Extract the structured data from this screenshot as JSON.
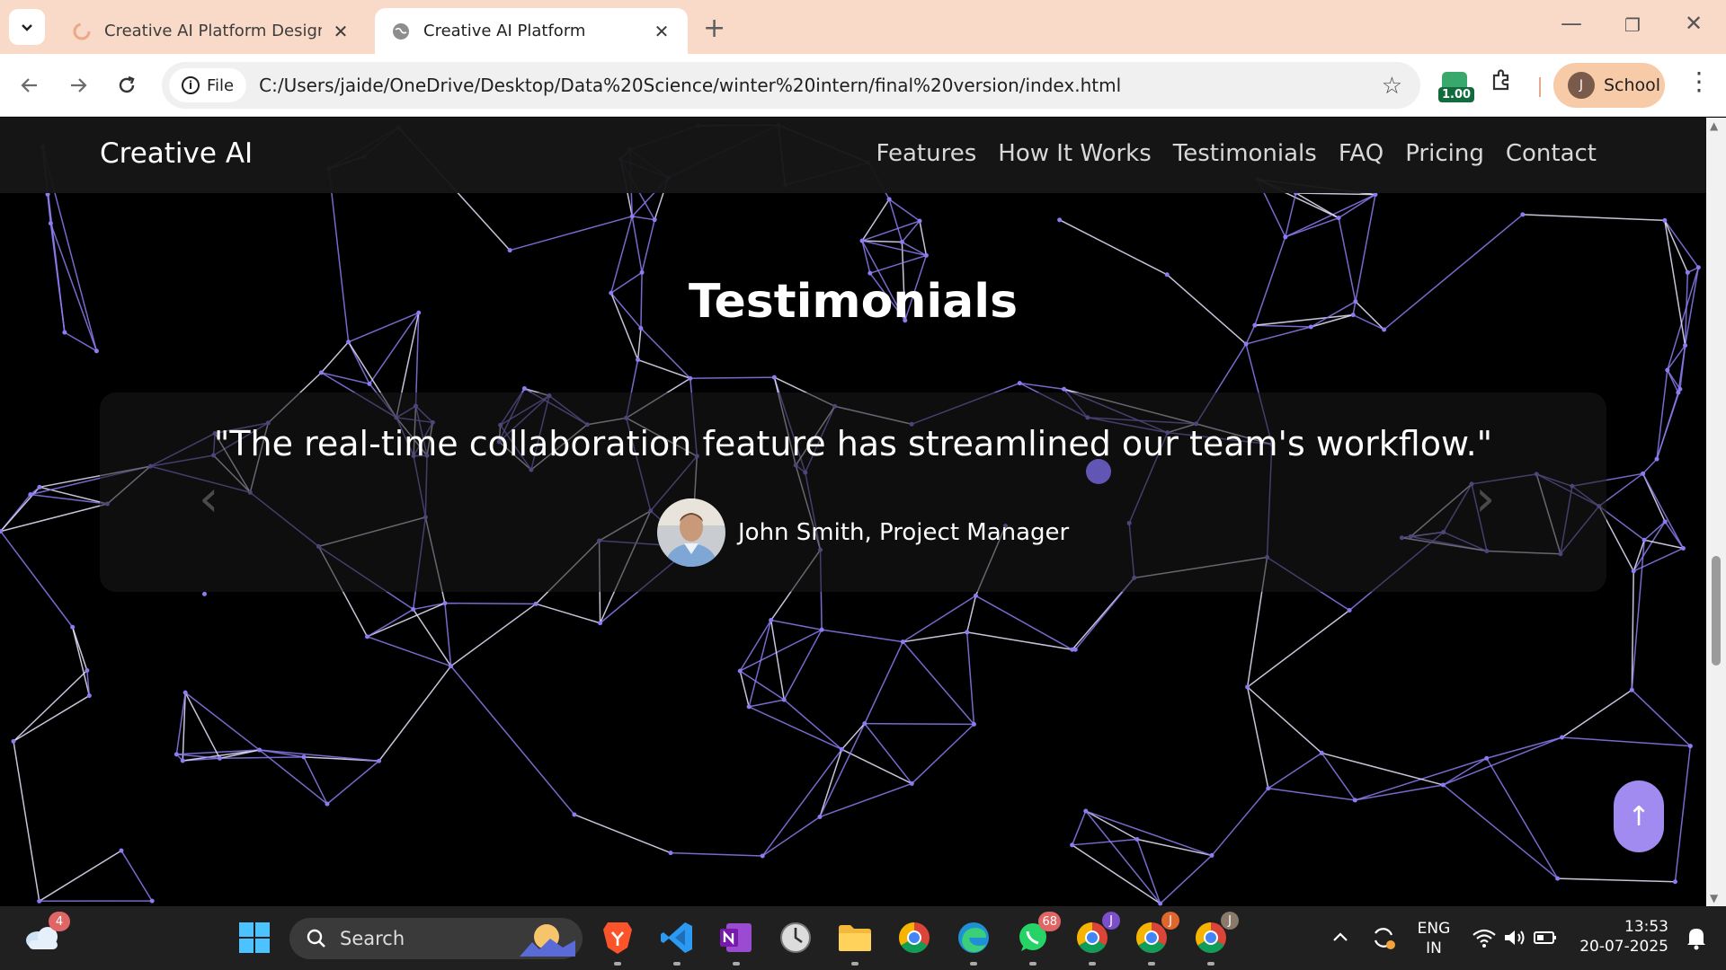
{
  "browser": {
    "tabs": [
      {
        "title": "Creative AI Platform Design - Gemini",
        "active": false
      },
      {
        "title": "Creative AI Platform",
        "active": true
      }
    ],
    "site_chip_label": "File",
    "url": "C:/Users/jaide/OneDrive/Desktop/Data%20Science/winter%20intern/final%20version/index.html",
    "extension_badge": "1.00",
    "profile": {
      "initial": "J",
      "label": "School"
    }
  },
  "site": {
    "brand": "Creative AI",
    "nav": [
      "Features",
      "How It Works",
      "Testimonials",
      "FAQ",
      "Pricing",
      "Contact"
    ],
    "section_title": "Testimonials",
    "testimonial": {
      "quote": "\"The real-time collaboration feature has streamlined our team's workflow.\"",
      "author": "John Smith, Project Manager"
    },
    "back_to_top": "↑",
    "accent_color": "#a18af0",
    "network_line_color": "#8b7cf0"
  },
  "taskbar": {
    "weather_badge": "4",
    "search_placeholder": "Search",
    "whatsapp_badge": "68",
    "chrome_profiles": [
      "J",
      "J",
      "J"
    ],
    "language": "ENG",
    "region": "IN",
    "time": "13:53",
    "date": "20-07-2025"
  }
}
